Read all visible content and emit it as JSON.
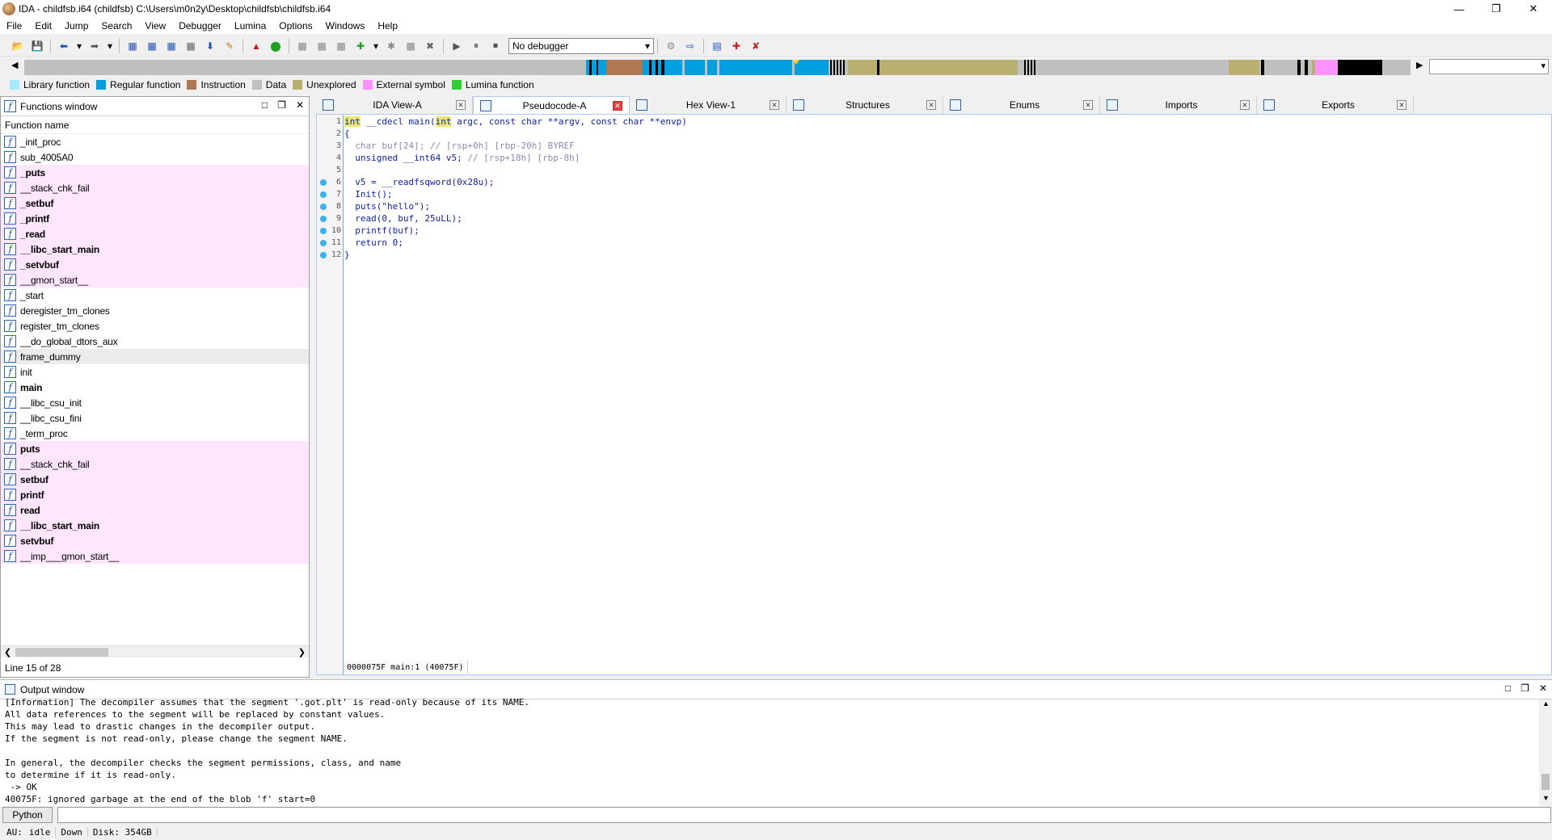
{
  "titlebar": {
    "title": "IDA - childfsb.i64 (childfsb) C:\\Users\\m0n2y\\Desktop\\childfsb\\childfsb.i64"
  },
  "menu": [
    "File",
    "Edit",
    "Jump",
    "Search",
    "View",
    "Debugger",
    "Lumina",
    "Options",
    "Windows",
    "Help"
  ],
  "toolbar": {
    "debugger_select": "No debugger"
  },
  "legend": [
    {
      "label": "Library function",
      "color": "#a6e8ff"
    },
    {
      "label": "Regular function",
      "color": "#00a0e0"
    },
    {
      "label": "Instruction",
      "color": "#b07850"
    },
    {
      "label": "Data",
      "color": "#c0c0c0"
    },
    {
      "label": "Unexplored",
      "color": "#b8b070"
    },
    {
      "label": "External symbol",
      "color": "#ff90ff"
    },
    {
      "label": "Lumina function",
      "color": "#30d030"
    }
  ],
  "functions_window": {
    "title": "Functions window",
    "column": "Function name",
    "status": "Line 15 of 28",
    "items": [
      {
        "name": "_init_proc",
        "style": "normal"
      },
      {
        "name": "sub_4005A0",
        "style": "normal"
      },
      {
        "name": "_puts",
        "style": "pinkbold"
      },
      {
        "name": "__stack_chk_fail",
        "style": "pink"
      },
      {
        "name": "_setbuf",
        "style": "pinkbold"
      },
      {
        "name": "_printf",
        "style": "pinkbold"
      },
      {
        "name": "_read",
        "style": "pinkbold"
      },
      {
        "name": "__libc_start_main",
        "style": "pinkbold"
      },
      {
        "name": "_setvbuf",
        "style": "pinkbold"
      },
      {
        "name": "__gmon_start__",
        "style": "pink"
      },
      {
        "name": "_start",
        "style": "normal"
      },
      {
        "name": "deregister_tm_clones",
        "style": "normal"
      },
      {
        "name": "register_tm_clones",
        "style": "normal"
      },
      {
        "name": "__do_global_dtors_aux",
        "style": "normal"
      },
      {
        "name": "frame_dummy",
        "style": "selected"
      },
      {
        "name": "init",
        "style": "normal"
      },
      {
        "name": "main",
        "style": "bold"
      },
      {
        "name": "__libc_csu_init",
        "style": "normal"
      },
      {
        "name": "__libc_csu_fini",
        "style": "normal"
      },
      {
        "name": "_term_proc",
        "style": "normal"
      },
      {
        "name": "puts",
        "style": "pinkbold"
      },
      {
        "name": "__stack_chk_fail",
        "style": "pink"
      },
      {
        "name": "setbuf",
        "style": "pinkbold"
      },
      {
        "name": "printf",
        "style": "pinkbold"
      },
      {
        "name": "read",
        "style": "pinkbold"
      },
      {
        "name": "__libc_start_main",
        "style": "pinkbold"
      },
      {
        "name": "setvbuf",
        "style": "pinkbold"
      },
      {
        "name": "__imp___gmon_start__",
        "style": "pink"
      }
    ]
  },
  "tabs": [
    {
      "label": "IDA View-A",
      "active": false
    },
    {
      "label": "Pseudocode-A",
      "active": true
    },
    {
      "label": "Hex View-1",
      "active": false
    },
    {
      "label": "Structures",
      "active": false
    },
    {
      "label": "Enums",
      "active": false
    },
    {
      "label": "Imports",
      "active": false
    },
    {
      "label": "Exports",
      "active": false
    }
  ],
  "code": {
    "lines": [
      {
        "n": "1",
        "bp": false
      },
      {
        "n": "2",
        "bp": false
      },
      {
        "n": "3",
        "bp": false
      },
      {
        "n": "4",
        "bp": false
      },
      {
        "n": "5",
        "bp": false
      },
      {
        "n": "6",
        "bp": true
      },
      {
        "n": "7",
        "bp": true
      },
      {
        "n": "8",
        "bp": true
      },
      {
        "n": "9",
        "bp": true
      },
      {
        "n": "10",
        "bp": true
      },
      {
        "n": "11",
        "bp": true
      },
      {
        "n": "12",
        "bp": true
      }
    ],
    "l1": {
      "kw1": "int",
      "p1": " __cdecl main(",
      "kw2": "int",
      "p2": " argc, const char **argv, const char **envp)"
    },
    "l2": "{",
    "l3": {
      "code": "  char buf[24]; ",
      "comment": "// [rsp+0h] [rbp-20h] BYREF"
    },
    "l4": {
      "code": "  unsigned __int64 v5; ",
      "comment": "// [rsp+18h] [rbp-8h]"
    },
    "l6": "  v5 = __readfsqword(0x28u);",
    "l7": "  Init();",
    "l8": "  puts(\"hello\");",
    "l9": "  read(0, buf, 25uLL);",
    "l10": "  printf(buf);",
    "l11": "  return 0;",
    "l12": "}",
    "status": "0000075F main:1 (40075F)"
  },
  "output_window": {
    "title": "Output window",
    "lines": [
      "[Information] The decompiler assumes that the segment '.got.plt' is read-only because of its NAME.",
      "All data references to the segment will be replaced by constant values.",
      "This may lead to drastic changes in the decompiler output.",
      "If the segment is not read-only, please change the segment NAME.",
      "",
      "In general, the decompiler checks the segment permissions, class, and name",
      "to determine if it is read-only.",
      " -> OK",
      "40075F: ignored garbage at the end of the blob 'f' start=0"
    ]
  },
  "python": {
    "label": "Python",
    "value": ""
  },
  "statusbar": {
    "au": "AU:",
    "state": "idle",
    "dir": "Down",
    "disk": "Disk: 354GB"
  },
  "navbar_colors": {
    "regular": "#00a0e0",
    "unexplored": "#b8b070",
    "data": "#c0c0c0",
    "external": "#ff90ff",
    "black": "#000000",
    "instruction": "#b07850"
  }
}
